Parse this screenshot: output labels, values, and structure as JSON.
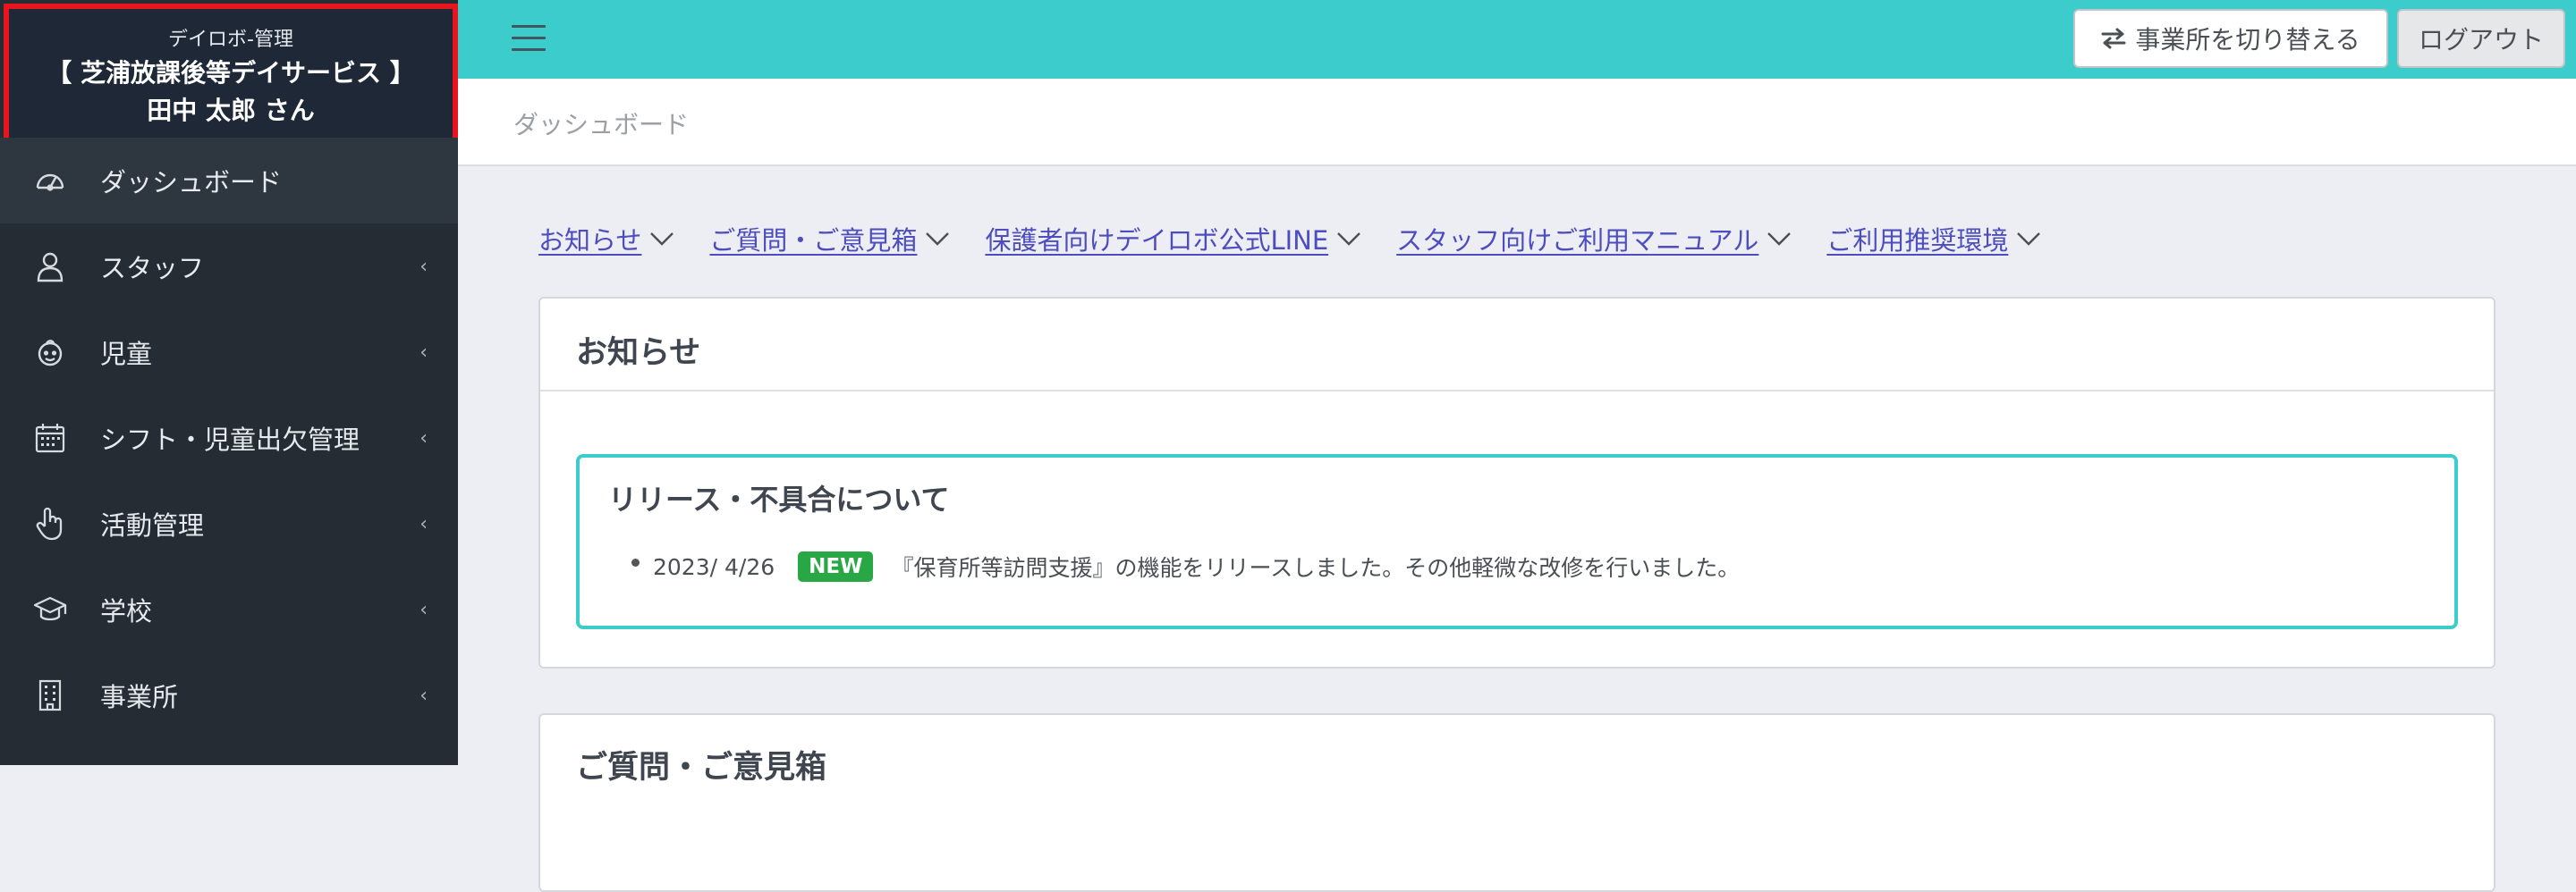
{
  "sidebar": {
    "brand": {
      "app": "デイロボ-管理",
      "office": "【 芝浦放課後等デイサービス 】",
      "user": "田中 太郎 さん"
    },
    "items": [
      {
        "label": "ダッシュボード",
        "icon": "dashboard-icon",
        "active": true
      },
      {
        "label": "スタッフ",
        "icon": "user-icon"
      },
      {
        "label": "児童",
        "icon": "child-icon"
      },
      {
        "label": "シフト・児童出欠管理",
        "icon": "calendar-icon"
      },
      {
        "label": "活動管理",
        "icon": "hand-pointer-icon"
      },
      {
        "label": "学校",
        "icon": "graduation-cap-icon"
      },
      {
        "label": "事業所",
        "icon": "building-icon"
      }
    ],
    "chevron": "‹"
  },
  "topbar": {
    "switch_label": "事業所を切り替える",
    "logout_label": "ログアウト",
    "accent": "#3ccccb"
  },
  "breadcrumb": "ダッシュボード",
  "links": [
    {
      "label": "お知らせ"
    },
    {
      "label": "ご質問・ご意見箱"
    },
    {
      "label": "保護者向けデイロボ公式LINE"
    },
    {
      "label": "スタッフ向けご利用マニュアル"
    },
    {
      "label": "ご利用推奨環境"
    }
  ],
  "news": {
    "title": "お知らせ",
    "release": {
      "title": "リリース・不具合について",
      "items": [
        {
          "date": "2023/ 4/26",
          "badge": "NEW",
          "text": "『保育所等訪問支援』の機能をリリースしました。その他軽微な改修を行いました。"
        }
      ]
    }
  },
  "feedback": {
    "title": "ご質問・ご意見箱"
  }
}
